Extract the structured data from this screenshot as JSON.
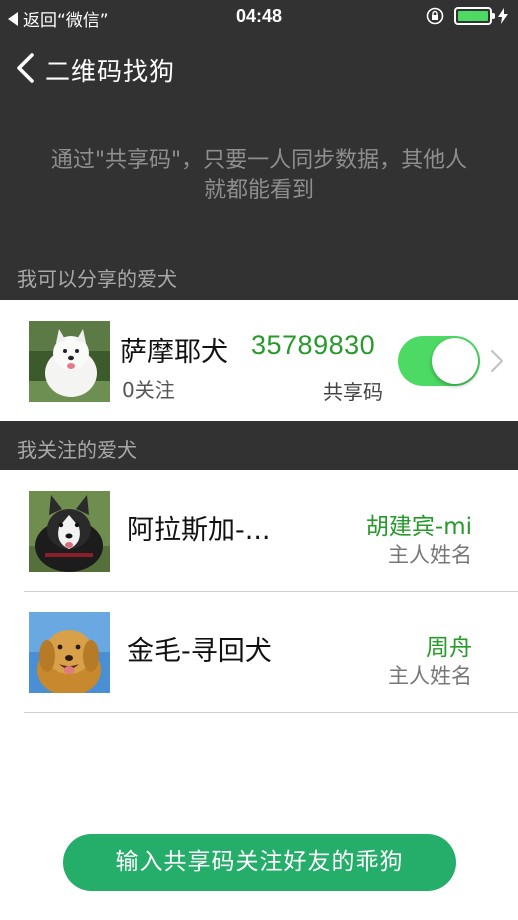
{
  "status_bar": {
    "back_label": "返回“微信”",
    "time": "04:48",
    "battery_color": "#4cd964"
  },
  "nav": {
    "back_icon": "chevron-left-icon",
    "title": "二维码找狗"
  },
  "intro_text": "通过\"共享码\"，只要一人同步数据，其他人就都能看到",
  "sections": {
    "shareable_header": "我可以分享的爱犬",
    "followed_header": "我关注的爱犬"
  },
  "shared_pet": {
    "name": "萨摩耶犬",
    "followers": "0关注",
    "share_code": "35789830",
    "share_code_label": "共享码",
    "share_enabled": true
  },
  "followed_pets": [
    {
      "name": "阿拉斯加-...",
      "owner": "胡建宾-mi",
      "owner_label": "主人姓名"
    },
    {
      "name": "金毛-寻回犬",
      "owner": "周舟",
      "owner_label": "主人姓名"
    }
  ],
  "bottom_button": "输入共享码关注好友的乖狗",
  "colors": {
    "dark_bg": "#323232",
    "accent_green": "#279a2b",
    "toggle_green": "#4cd964",
    "button_green": "#25ad6a"
  }
}
